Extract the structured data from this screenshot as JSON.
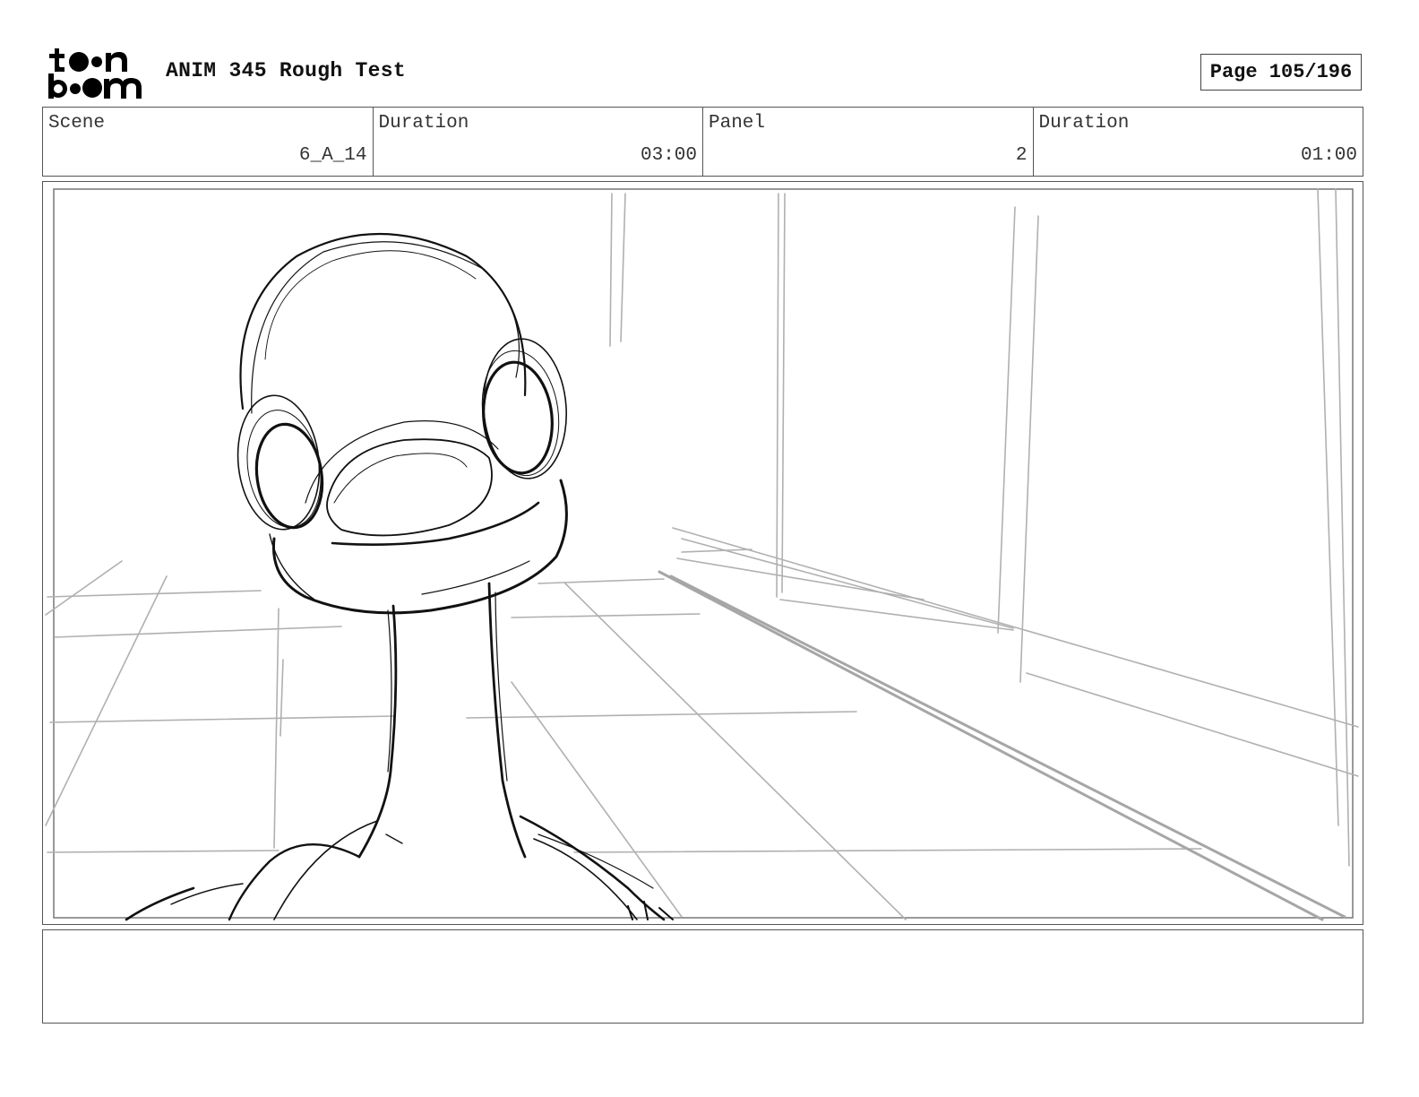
{
  "header": {
    "logo_text": "toon boom",
    "project_title": "ANIM 345 Rough Test",
    "page_label": "Page 105/196"
  },
  "info": {
    "scene_label": "Scene",
    "scene_value": "6_A_14",
    "scene_duration_label": "Duration",
    "scene_duration_value": "03:00",
    "panel_label": "Panel",
    "panel_value": "2",
    "panel_duration_label": "Duration",
    "panel_duration_value": "01:00"
  },
  "notes": {
    "text": ""
  }
}
